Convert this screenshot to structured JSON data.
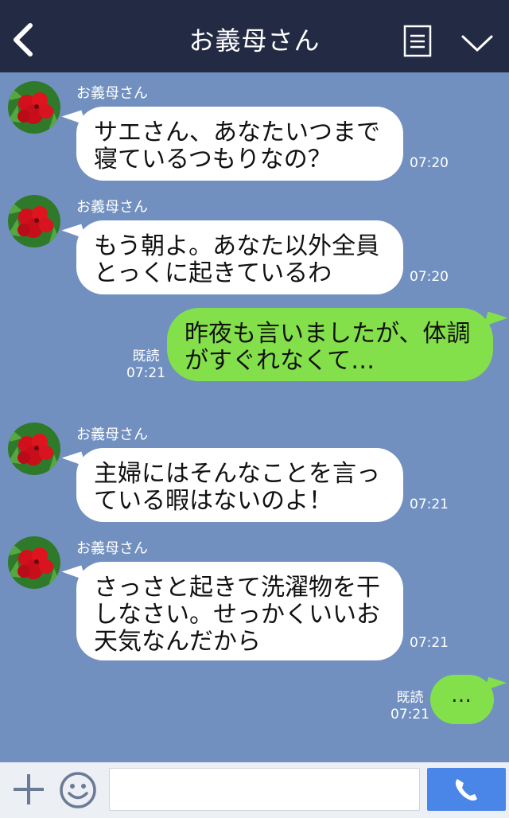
{
  "header": {
    "title": "お義母さん",
    "back_icon": "chevron-left-icon",
    "menu_icon": "menu-icon",
    "expand_icon": "chevron-down-icon"
  },
  "messages": [
    {
      "direction": "incoming",
      "sender": "お義母さん",
      "lines": [
        "サエさん、あなたいつまで",
        "寝ているつもりなの？"
      ],
      "time": "07:20"
    },
    {
      "direction": "incoming",
      "sender": "お義母さん",
      "lines": [
        "もう朝よ。あなた以外全員",
        "とっくに起きているわ"
      ],
      "time": "07:20"
    },
    {
      "direction": "outgoing",
      "read": "既読",
      "lines": [
        "昨夜も言いましたが、体調",
        "がすぐれなくて…"
      ],
      "time": "07:21"
    },
    {
      "direction": "incoming",
      "sender": "お義母さん",
      "lines": [
        "主婦にはそんなことを言っ",
        "ている暇はないのよ！"
      ],
      "time": "07:21"
    },
    {
      "direction": "incoming",
      "sender": "お義母さん",
      "lines": [
        "さっさと起きて洗濯物を干",
        "しなさい。せっかくいいお",
        "天気なんだから"
      ],
      "time": "07:21"
    },
    {
      "direction": "outgoing",
      "read": "既読",
      "text": "…",
      "time": "07:21"
    }
  ],
  "footer": {
    "input_value": "",
    "plus_icon": "plus-icon",
    "emoji_icon": "smiley-icon",
    "call_icon": "phone-icon"
  },
  "colors": {
    "header_bg": "#232b44",
    "chat_bg": "#7190c0",
    "bubble_in": "#ffffff",
    "bubble_out": "#84e04a",
    "call_button": "#4a86e8"
  }
}
